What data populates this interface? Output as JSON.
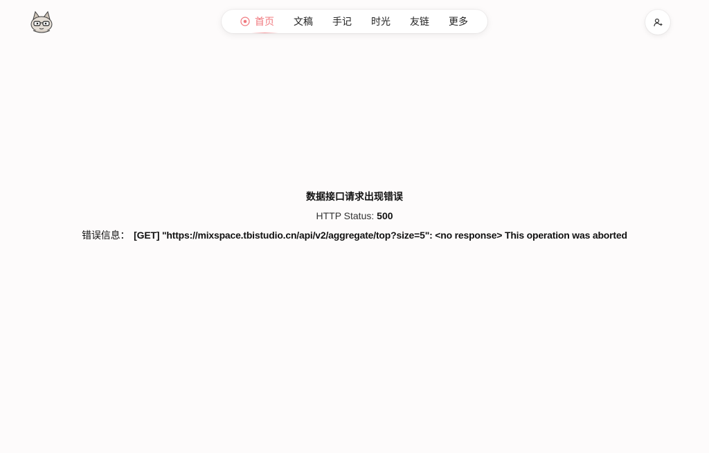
{
  "nav": {
    "items": [
      {
        "label": "首页",
        "active": true
      },
      {
        "label": "文稿",
        "active": false
      },
      {
        "label": "手记",
        "active": false
      },
      {
        "label": "时光",
        "active": false
      },
      {
        "label": "友链",
        "active": false
      },
      {
        "label": "更多",
        "active": false
      }
    ],
    "accent_color": "#f0787e"
  },
  "header": {
    "logo_icon": "cat-avatar-logo",
    "user_icon": "user-plus-icon"
  },
  "error": {
    "title": "数据接口请求出现错误",
    "status_label": "HTTP Status:",
    "status_code": "500",
    "message_label": "错误信息：",
    "message_text": "[GET] \"https://mixspace.tbistudio.cn/api/v2/aggregate/top?size=5\": <no response> This operation was aborted"
  }
}
